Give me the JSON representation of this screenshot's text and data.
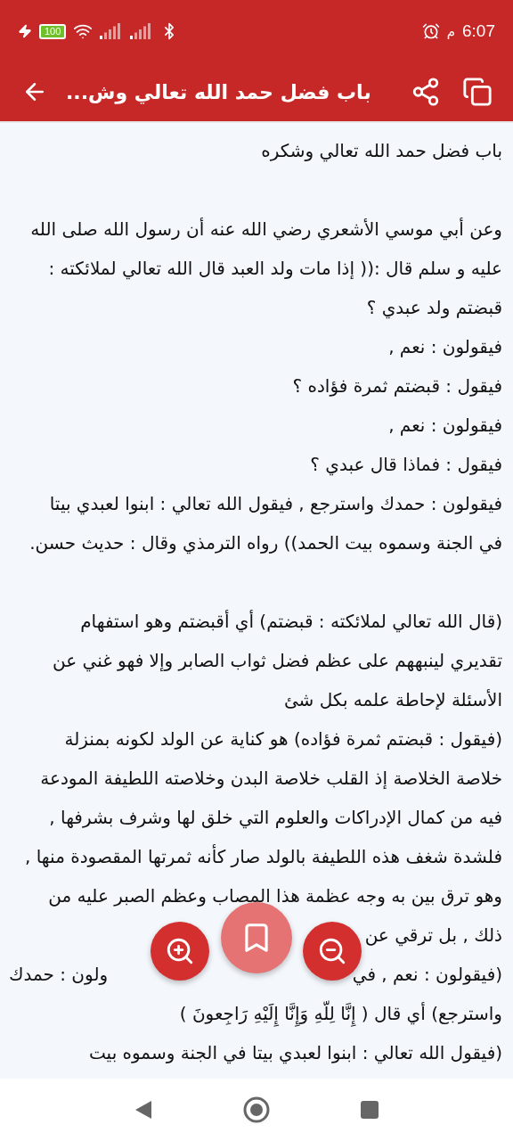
{
  "status_bar": {
    "time": "6:07",
    "period": "م",
    "battery": "100"
  },
  "app_bar": {
    "title": "باب فضل حمد الله تعالي وش..."
  },
  "blocks": [
    {
      "lines": [
        {
          "parts": [
            "باب فضل حمد الله تعالي وشكره"
          ]
        }
      ]
    },
    {
      "lines": [
        {
          "parts": [
            "وعن أبي موسي الأشعري رضي الله عنه أن رسول الله صلى الله"
          ]
        },
        {
          "parts": [
            "عليه و سلم قال :(( إذا مات ولد العبد قال الله تعالي لملائكته :"
          ]
        },
        {
          "parts": [
            "قبضتم ولد عبدي ؟"
          ]
        },
        {
          "parts": [
            "فيقولون : نعم ,"
          ]
        },
        {
          "parts": [
            "فيقول : قبضتم ثمرة فؤاده ؟"
          ]
        },
        {
          "parts": [
            "فيقولون : نعم ,"
          ]
        },
        {
          "parts": [
            "فيقول : فماذا قال عبدي ؟"
          ]
        },
        {
          "parts": [
            "فيقولون : حمدك واسترجع , فيقول الله تعالي : ابنوا لعبدي بيتا"
          ]
        },
        {
          "parts": [
            "في الجنة وسموه بيت الحمد)) رواه الترمذي وقال : حديث حسن."
          ]
        }
      ]
    },
    {
      "lines": [
        {
          "parts": [
            "(قال الله تعالي لملائكته : قبضتم) أي أقبضتم وهو استفهام"
          ]
        },
        {
          "parts": [
            "تقديري لينبههم على عظم فضل ثواب الصابر وإلا فهو غني عن"
          ]
        },
        {
          "parts": [
            "الأسئلة لإحاطة علمه بكل شئ"
          ]
        },
        {
          "parts": [
            "(فيقول : قبضتم ثمرة فؤاده) هو كناية عن الولد لكونه بمنزلة"
          ]
        },
        {
          "parts": [
            "خلاصة الخلاصة إذ القلب خلاصة البدن وخلاصته اللطيفة المودعة"
          ]
        },
        {
          "parts": [
            "فيه من كمال الإدراكات والعلوم التي خلق لها وشرف بشرفها ,"
          ]
        },
        {
          "parts": [
            "فلشدة شغف هذه اللطيفة بالولد صار كأنه ثمرتها المقصودة منها ,"
          ]
        },
        {
          "parts": [
            "وهو ترق بين به وجه عظمة هذا المصاب وعظم الصبر عليه من"
          ]
        },
        {
          "parts": [
            "ذلك , بل ترقي عن"
          ]
        },
        {
          "parts": [
            "(فيقولون : نعم , في",
            "ولون : حمدك"
          ]
        },
        {
          "parts": [
            "واسترجع) أي قال ( إِنَّا لِلّهِ وَإِنَّا إِلَيْهِ رَاجِعونَ )"
          ]
        },
        {
          "parts": [
            "(فيقول الله تعالي : ابنوا لعبدي بيتا في الجنة وسموه بيت"
          ]
        }
      ]
    }
  ]
}
